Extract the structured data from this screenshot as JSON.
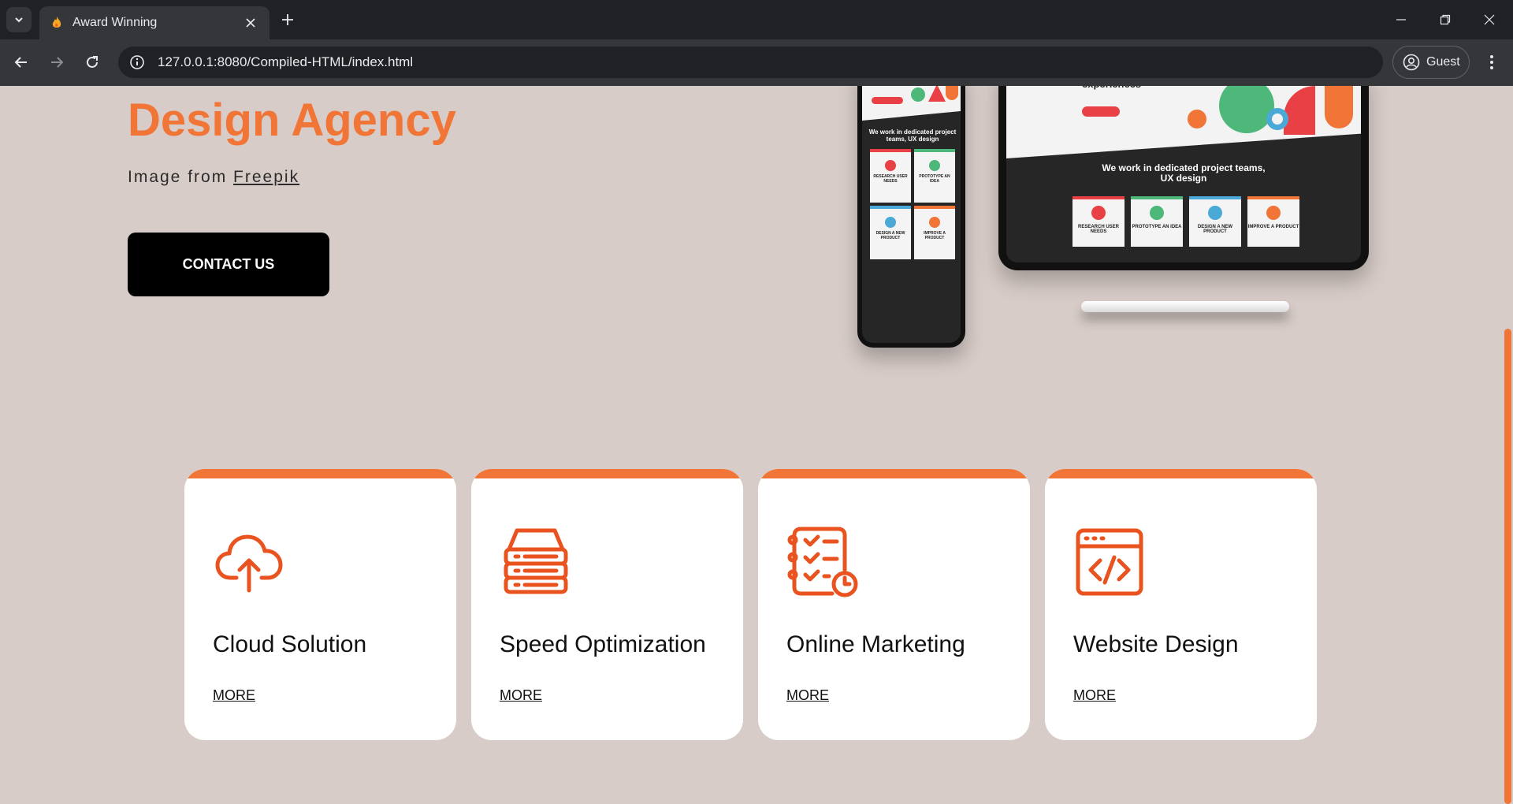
{
  "browser": {
    "tab_title": "Award Winning",
    "url": "127.0.0.1:8080/Compiled-HTML/index.html",
    "profile_label": "Guest"
  },
  "hero": {
    "title": "Design Agency",
    "credit_prefix": "Image from",
    "credit_link": "Freepik",
    "contact_label": "CONTACT US"
  },
  "mockup": {
    "tablet_heading": "experiences",
    "tablet_section_title": "We work in dedicated project teams, UX design",
    "phone_section_title": "We work in dedicated project teams, UX design",
    "mini_cards": [
      "RESEARCH USER NEEDS",
      "PROTOTYPE AN IDEA",
      "DESIGN A NEW PRODUCT",
      "IMPROVE A PRODUCT"
    ]
  },
  "services": [
    {
      "title": "Cloud Solution",
      "more": "MORE",
      "icon": "cloud-upload-icon"
    },
    {
      "title": "Speed Optimization",
      "more": "MORE",
      "icon": "server-stack-icon"
    },
    {
      "title": "Online Marketing",
      "more": "MORE",
      "icon": "checklist-clock-icon"
    },
    {
      "title": "Website Design",
      "more": "MORE",
      "icon": "code-window-icon"
    }
  ],
  "colors": {
    "accent": "#f07536",
    "page_bg": "#d8ccc8",
    "button": "#000000"
  }
}
